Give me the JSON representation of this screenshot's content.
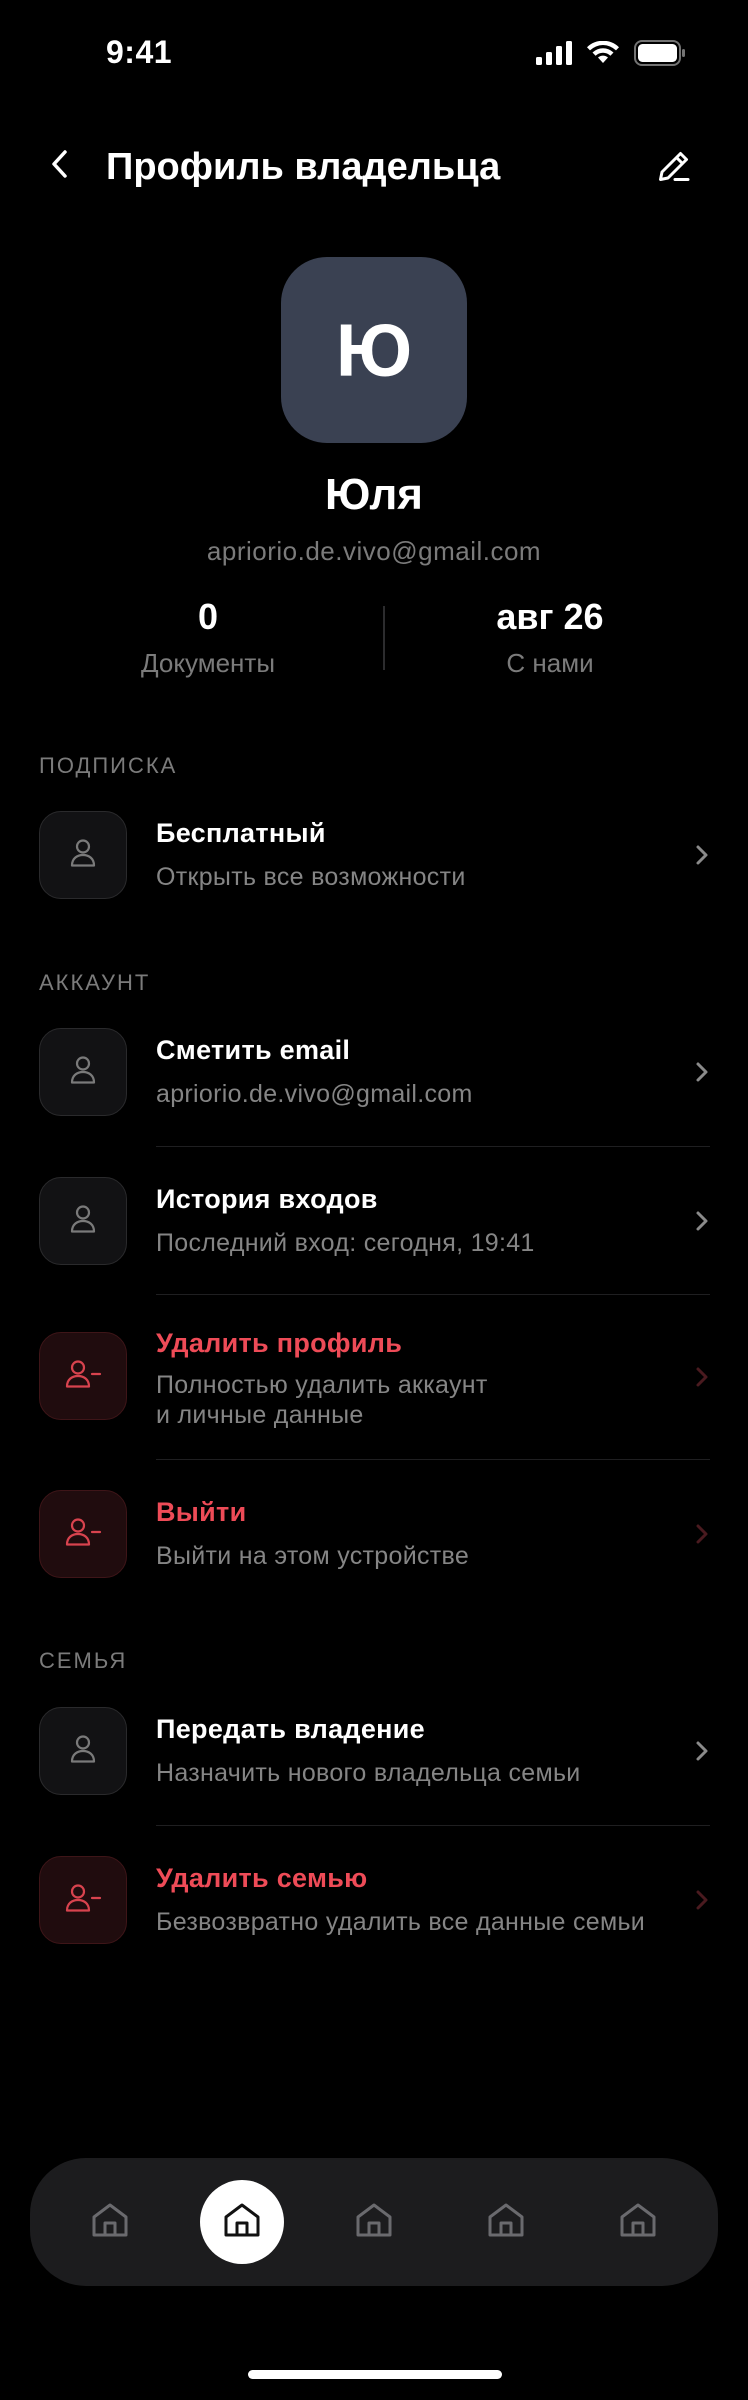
{
  "status_bar": {
    "time": "9:41"
  },
  "header": {
    "title": "Профиль владельца"
  },
  "profile": {
    "initial": "Ю",
    "name": "Юля",
    "email": "apriorio.de.vivo@gmail.com",
    "stats": [
      {
        "value": "0",
        "label": "Документы"
      },
      {
        "value": "авг 26",
        "label": "С нами"
      }
    ]
  },
  "sections": {
    "subscription": {
      "title": "ПОДПИСКА",
      "items": [
        {
          "title": "Бесплатный",
          "subtitle": "Открыть все возможности",
          "danger": false
        }
      ]
    },
    "account": {
      "title": "АККАУНТ",
      "items": [
        {
          "title": "Сметить email",
          "subtitle": "apriorio.de.vivo@gmail.com",
          "danger": false
        },
        {
          "title": "История входов",
          "subtitle": "Последний вход: сегодня, 19:41",
          "danger": false
        },
        {
          "title": "Удалить профиль",
          "subtitle": "Полностью удалить аккаунт\nи личные данные",
          "danger": true
        },
        {
          "title": "Выйти",
          "subtitle": "Выйти на этом устройстве",
          "danger": true
        }
      ]
    },
    "family": {
      "title": "СЕМЬЯ",
      "items": [
        {
          "title": "Передать владение",
          "subtitle": "Назначить нового владельца семьи",
          "danger": false
        },
        {
          "title": "Удалить семью",
          "subtitle": "Безвозвратно удалить все данные семьи",
          "danger": true
        }
      ]
    }
  },
  "tab_bar": {
    "active_index": 1,
    "tabs": [
      {
        "icon": "home-icon"
      },
      {
        "icon": "home-icon"
      },
      {
        "icon": "home-icon"
      },
      {
        "icon": "home-icon"
      },
      {
        "icon": "home-icon"
      }
    ]
  },
  "colors": {
    "background": "#000000",
    "accent_danger": "#ee4b57",
    "avatar_bg": "#3a4152",
    "muted_text": "#7b7b7b",
    "tab_bar_bg": "#1c1c1e"
  }
}
